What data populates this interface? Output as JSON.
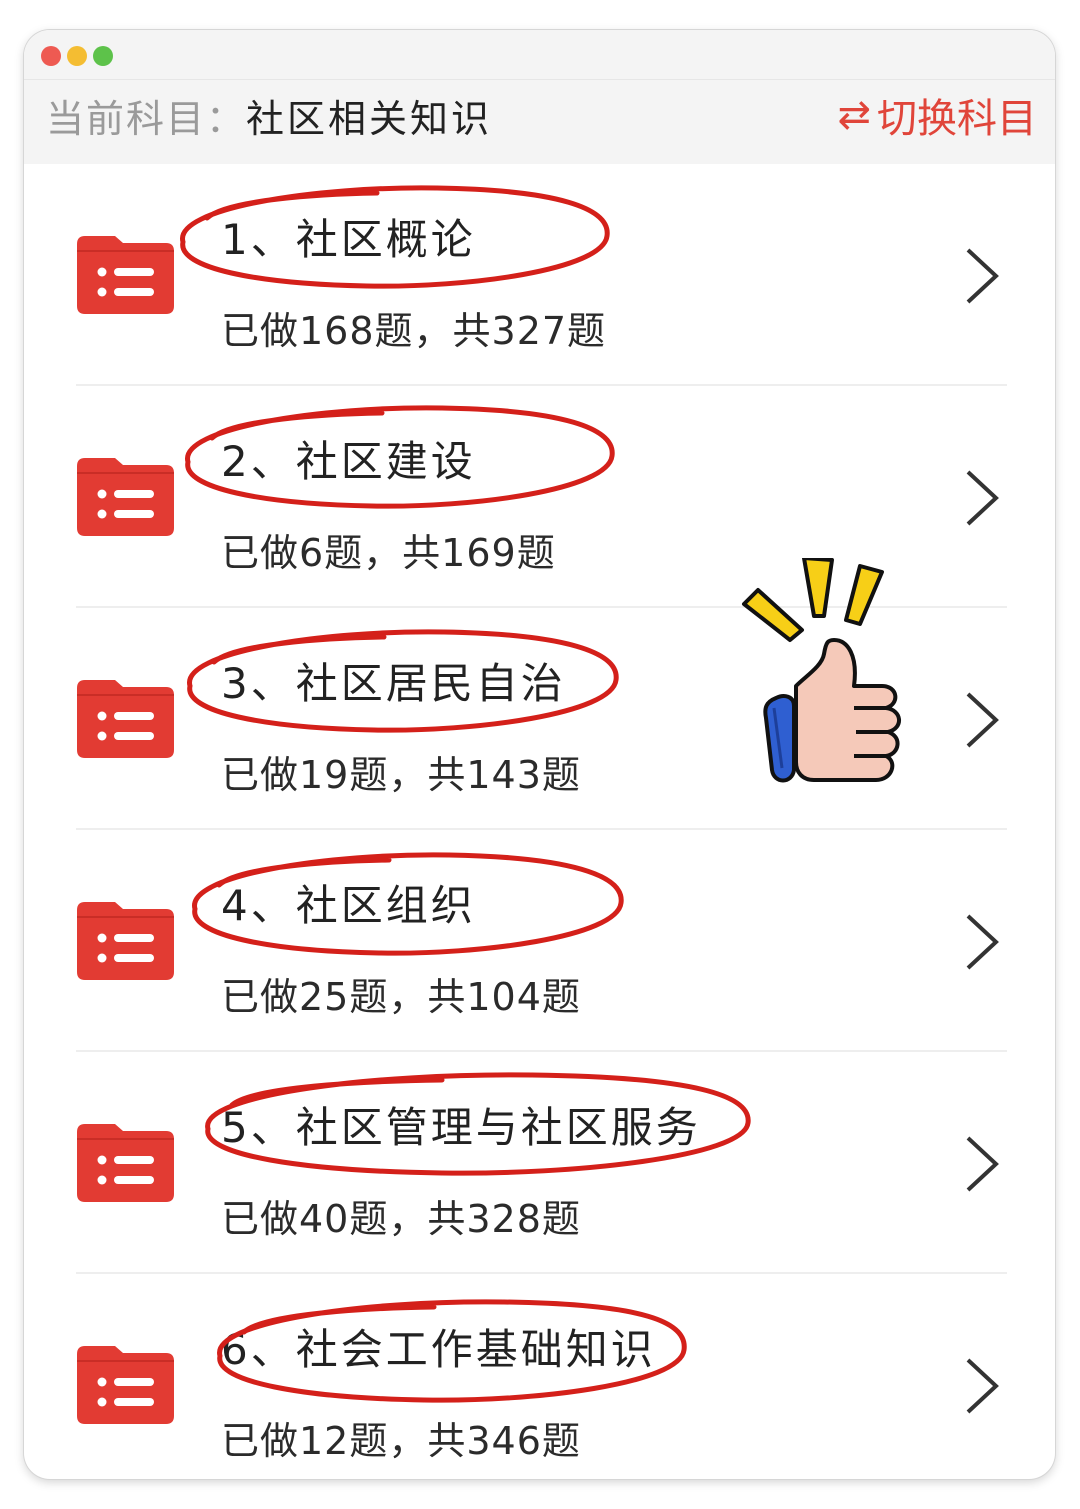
{
  "window": {
    "controls": [
      "close",
      "minimize",
      "maximize"
    ]
  },
  "header": {
    "current_label": "当前科目：",
    "current_value": "社区相关知识",
    "switch_icon": "⇄",
    "switch_label": "切换科目"
  },
  "chapters": [
    {
      "title": "1、社区概论",
      "progress": "已做168题，共327题",
      "done": 168,
      "total": 327
    },
    {
      "title": "2、社区建设",
      "progress": "已做6题，共169题",
      "done": 6,
      "total": 169
    },
    {
      "title": "3、社区居民自治",
      "progress": "已做19题，共143题",
      "done": 19,
      "total": 143
    },
    {
      "title": "4、社区组织",
      "progress": "已做25题，共104题",
      "done": 25,
      "total": 104
    },
    {
      "title": "5、社区管理与社区服务",
      "progress": "已做40题，共328题",
      "done": 40,
      "total": 328
    },
    {
      "title": "6、社会工作基础知识",
      "progress": "已做12题，共346题",
      "done": 12,
      "total": 346
    }
  ],
  "colors": {
    "accent": "#e0453a",
    "folder": "#e23b33",
    "annotation": "#d4201a"
  },
  "icons": {
    "folder": "folder-list-icon",
    "chevron": "chevron-right-icon",
    "sticker": "thumbs-up-sticker"
  }
}
